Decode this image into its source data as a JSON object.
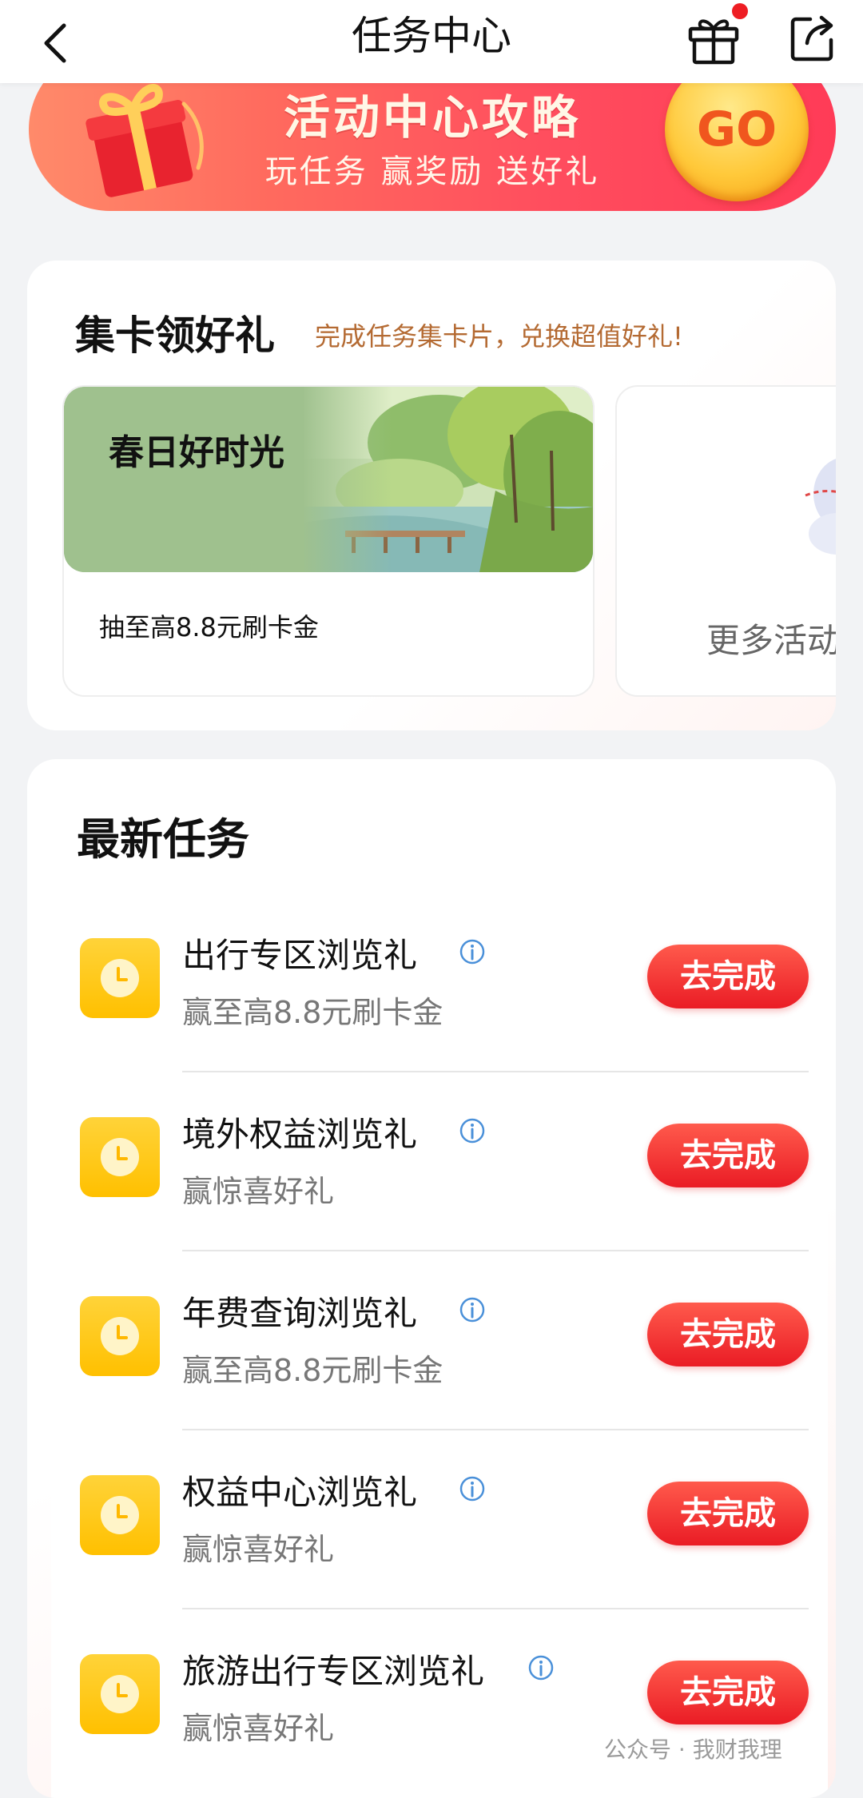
{
  "header": {
    "title": "任务中心"
  },
  "banner": {
    "title": "活动中心攻略",
    "subtitle": "玩任务 赢奖励 送好礼",
    "go_label": "GO"
  },
  "card_section": {
    "title": "集卡领好礼",
    "subtitle": "完成任务集卡片，兑换超值好礼!",
    "activity": {
      "name": "春日好时光",
      "description": "抽至高8.8元刷卡金"
    },
    "more_label": "更多活动"
  },
  "tasks": {
    "title": "最新任务",
    "items": [
      {
        "name": "出行专区浏览礼",
        "reward": "赢至高8.8元刷卡金",
        "button": "去完成"
      },
      {
        "name": "境外权益浏览礼",
        "reward": "赢惊喜好礼",
        "button": "去完成"
      },
      {
        "name": "年费查询浏览礼",
        "reward": "赢至高8.8元刷卡金",
        "button": "去完成"
      },
      {
        "name": "权益中心浏览礼",
        "reward": "赢惊喜好礼",
        "button": "去完成"
      },
      {
        "name": "旅游出行专区浏览礼",
        "reward": "赢惊喜好礼",
        "button": "去完成"
      }
    ]
  },
  "watermark": "公众号 · 我财我理",
  "colors": {
    "accent_red": "#ee1d23",
    "icon_yellow": "#ffc000",
    "banner_gradient_end": "#ff3b57"
  }
}
